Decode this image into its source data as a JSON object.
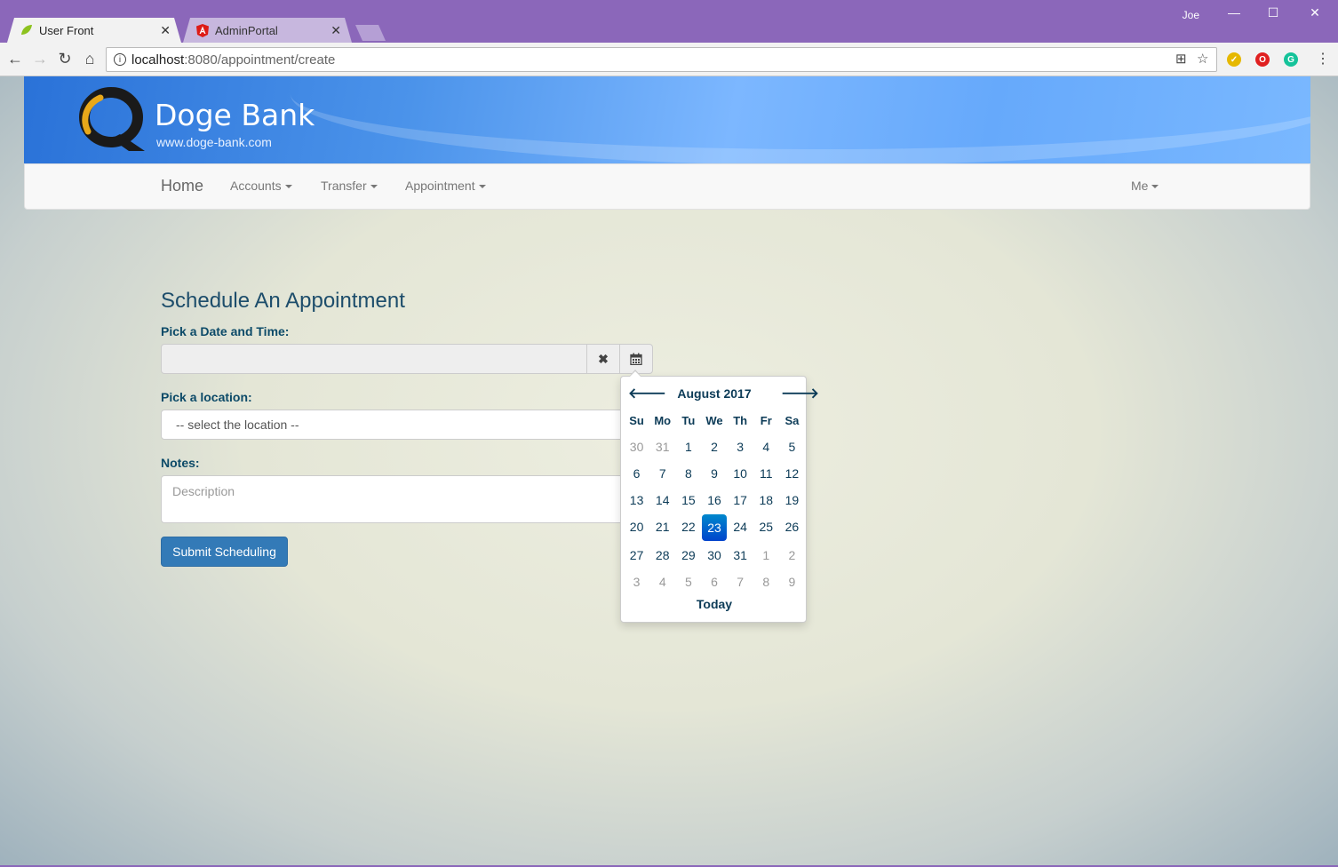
{
  "browser": {
    "tabs": [
      {
        "title": "User Front",
        "active": true
      },
      {
        "title": "AdminPortal",
        "active": false
      }
    ],
    "user_name": "Joe",
    "url_host": "localhost",
    "url_path": ":8080/appointment/create",
    "colors": {
      "frame": "#8b67ba"
    }
  },
  "banner": {
    "brand": "Doge Bank",
    "url": "www.doge-bank.com"
  },
  "nav": {
    "home": "Home",
    "items": [
      "Accounts",
      "Transfer",
      "Appointment"
    ],
    "right": "Me"
  },
  "form": {
    "title": "Schedule An Appointment",
    "date_label": "Pick a Date and Time:",
    "date_value": "",
    "location_label": "Pick a location:",
    "location_selected": "-- select the location --",
    "notes_label": "Notes:",
    "notes_placeholder": "Description",
    "submit_label": "Submit Scheduling"
  },
  "datepicker": {
    "month_label": "August 2017",
    "weekdays": [
      "Su",
      "Mo",
      "Tu",
      "We",
      "Th",
      "Fr",
      "Sa"
    ],
    "days": [
      [
        "30",
        "31",
        "1",
        "2",
        "3",
        "4",
        "5"
      ],
      [
        "6",
        "7",
        "8",
        "9",
        "10",
        "11",
        "12"
      ],
      [
        "13",
        "14",
        "15",
        "16",
        "17",
        "18",
        "19"
      ],
      [
        "20",
        "21",
        "22",
        "23",
        "24",
        "25",
        "26"
      ],
      [
        "27",
        "28",
        "29",
        "30",
        "31",
        "1",
        "2"
      ],
      [
        "3",
        "4",
        "5",
        "6",
        "7",
        "8",
        "9"
      ]
    ],
    "selected_day": "23",
    "today_label": "Today",
    "colors": {
      "selected": "#0068cc",
      "text": "#0c3b57"
    }
  }
}
